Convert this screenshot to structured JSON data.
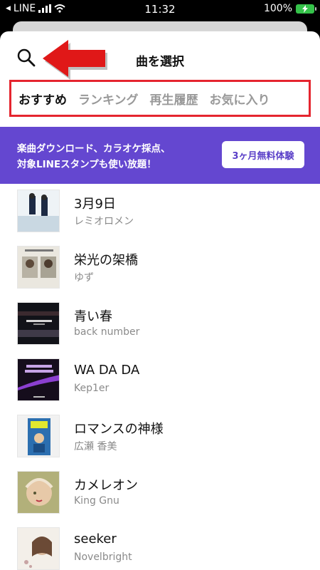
{
  "status_bar": {
    "carrier": "LINE",
    "time": "11:32",
    "battery": "100%"
  },
  "header": {
    "title": "曲を選択"
  },
  "tabs": [
    {
      "label": "おすすめ",
      "active": true
    },
    {
      "label": "ランキング",
      "active": false
    },
    {
      "label": "再生履歴",
      "active": false
    },
    {
      "label": "お気に入り",
      "active": false
    }
  ],
  "promo": {
    "line1": "楽曲ダウンロード、カラオケ採点、",
    "line2": "対象LINEスタンプも使い放題！",
    "button_label": "3ヶ月無料体験"
  },
  "songs": [
    {
      "title": "3月9日",
      "artist": "レミオロメン"
    },
    {
      "title": "栄光の架橋",
      "artist": "ゆず"
    },
    {
      "title": "青い春",
      "artist": "back number"
    },
    {
      "title": "WA DA DA",
      "artist": "Kep1er"
    },
    {
      "title": "ロマンスの神様",
      "artist": "広瀬 香美"
    },
    {
      "title": "カメレオン",
      "artist": "King Gnu"
    },
    {
      "title": "seeker",
      "artist": "Novelbright"
    }
  ],
  "colors": {
    "accent": "#6447d0",
    "highlight_box": "#e5252f",
    "battery": "#35c24a"
  }
}
